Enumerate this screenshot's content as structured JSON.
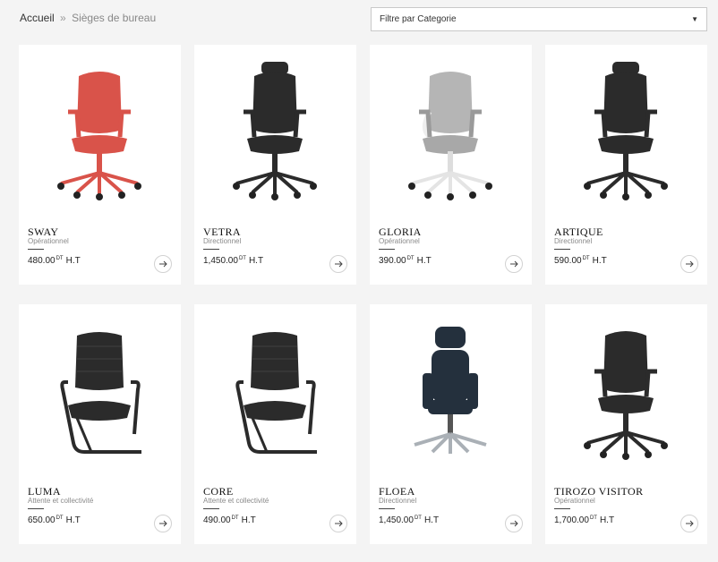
{
  "breadcrumb": {
    "home": "Accueil",
    "separator": "»",
    "current": "Sièges de bureau"
  },
  "filter": {
    "label": "Filtre par Categorie"
  },
  "products": [
    {
      "name": "SWAY",
      "category": "Opérationnel",
      "price": "480.00",
      "currency": "DT",
      "suffix": "H.T",
      "color": "#d9534a",
      "style": "task"
    },
    {
      "name": "VETRA",
      "category": "Directionnel",
      "price": "1,450.00",
      "currency": "DT",
      "suffix": "H.T",
      "color": "#2b2b2b",
      "style": "headrest"
    },
    {
      "name": "GLORIA",
      "category": "Opérationnel",
      "price": "390.00",
      "currency": "DT",
      "suffix": "H.T",
      "color": "#9a9a9a",
      "style": "white"
    },
    {
      "name": "ARTIQUE",
      "category": "Directionnel",
      "price": "590.00",
      "currency": "DT",
      "suffix": "H.T",
      "color": "#2b2b2b",
      "style": "headrest"
    },
    {
      "name": "LUMA",
      "category": "Attente et collectivité",
      "price": "650.00",
      "currency": "DT",
      "suffix": "H.T",
      "color": "#2b2b2b",
      "style": "visitor"
    },
    {
      "name": "CORE",
      "category": "Attente et collectivité",
      "price": "490.00",
      "currency": "DT",
      "suffix": "H.T",
      "color": "#2b2b2b",
      "style": "visitor"
    },
    {
      "name": "FLOEA",
      "category": "Directionnel",
      "price": "1,450.00",
      "currency": "DT",
      "suffix": "H.T",
      "color": "#24303d",
      "style": "leather"
    },
    {
      "name": "TIROZO VISITOR",
      "category": "Opérationnel",
      "price": "1,700.00",
      "currency": "DT",
      "suffix": "H.T",
      "color": "#2b2b2b",
      "style": "task"
    }
  ]
}
